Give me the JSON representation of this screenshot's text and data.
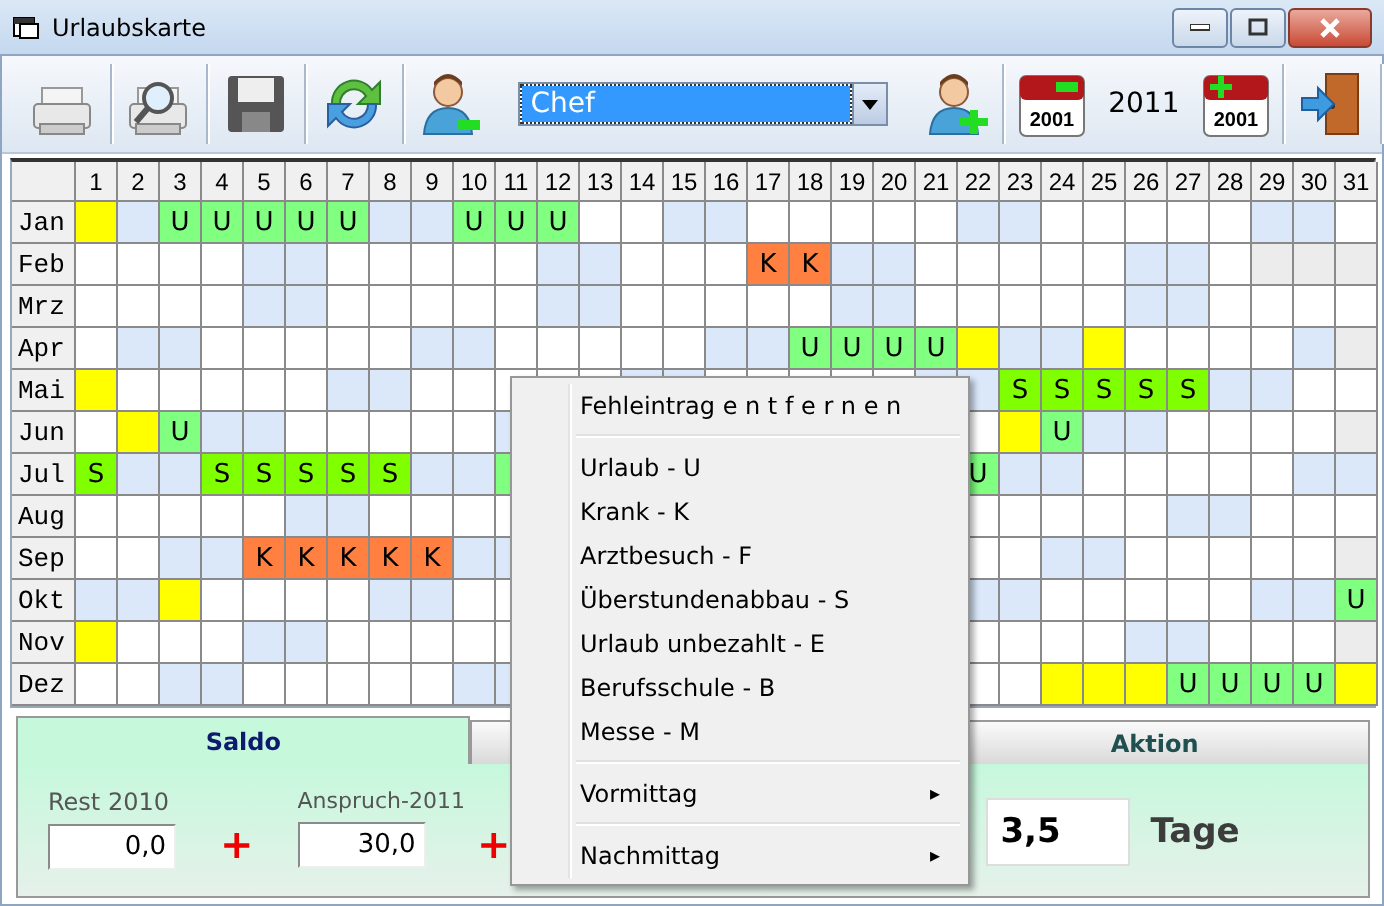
{
  "window": {
    "title": "Urlaubskarte"
  },
  "toolbar": {
    "user_select": "Chef",
    "prev_year_icon_text": "2001",
    "year": "2011",
    "next_year_icon_text": "2001"
  },
  "days": [
    "1",
    "2",
    "3",
    "4",
    "5",
    "6",
    "7",
    "8",
    "9",
    "10",
    "11",
    "12",
    "13",
    "14",
    "15",
    "16",
    "17",
    "18",
    "19",
    "20",
    "21",
    "22",
    "23",
    "24",
    "25",
    "26",
    "27",
    "28",
    "29",
    "30",
    "31"
  ],
  "months": [
    {
      "label": "Jan",
      "cells": [
        {
          "kind": "holiday"
        },
        {
          "kind": "weekend"
        },
        {
          "kind": "entry",
          "text": "U",
          "color": "#80ff80"
        },
        {
          "kind": "entry",
          "text": "U",
          "color": "#80ff80"
        },
        {
          "kind": "entry",
          "text": "U",
          "color": "#80ff80"
        },
        {
          "kind": "entry",
          "text": "U",
          "color": "#80ff80"
        },
        {
          "kind": "entry",
          "text": "U",
          "color": "#80ff80"
        },
        {
          "kind": "weekend"
        },
        {
          "kind": "weekend"
        },
        {
          "kind": "entry",
          "text": "U",
          "color": "#80ff80"
        },
        {
          "kind": "entry",
          "text": "U",
          "color": "#80ff80"
        },
        {
          "kind": "entry",
          "text": "U",
          "color": "#80ff80"
        },
        {
          "kind": "work"
        },
        {
          "kind": "work"
        },
        {
          "kind": "weekend"
        },
        {
          "kind": "weekend"
        },
        {
          "kind": "work"
        },
        {
          "kind": "work"
        },
        {
          "kind": "work"
        },
        {
          "kind": "work"
        },
        {
          "kind": "work"
        },
        {
          "kind": "weekend"
        },
        {
          "kind": "weekend"
        },
        {
          "kind": "work"
        },
        {
          "kind": "work"
        },
        {
          "kind": "work"
        },
        {
          "kind": "work"
        },
        {
          "kind": "work"
        },
        {
          "kind": "weekend"
        },
        {
          "kind": "weekend"
        },
        {
          "kind": "work"
        }
      ]
    },
    {
      "label": "Feb",
      "cells": [
        {
          "kind": "work"
        },
        {
          "kind": "work"
        },
        {
          "kind": "work"
        },
        {
          "kind": "work"
        },
        {
          "kind": "weekend"
        },
        {
          "kind": "weekend"
        },
        {
          "kind": "work"
        },
        {
          "kind": "work"
        },
        {
          "kind": "work"
        },
        {
          "kind": "work"
        },
        {
          "kind": "work"
        },
        {
          "kind": "weekend"
        },
        {
          "kind": "weekend"
        },
        {
          "kind": "work"
        },
        {
          "kind": "work"
        },
        {
          "kind": "work"
        },
        {
          "kind": "entry",
          "text": "K",
          "color": "#ff8040"
        },
        {
          "kind": "entry",
          "text": "K",
          "color": "#ff8040"
        },
        {
          "kind": "weekend"
        },
        {
          "kind": "weekend"
        },
        {
          "kind": "work"
        },
        {
          "kind": "work"
        },
        {
          "kind": "work"
        },
        {
          "kind": "work"
        },
        {
          "kind": "work"
        },
        {
          "kind": "weekend"
        },
        {
          "kind": "weekend"
        },
        {
          "kind": "work"
        },
        {
          "kind": "blank"
        },
        {
          "kind": "blank"
        },
        {
          "kind": "blank"
        }
      ]
    },
    {
      "label": "Mrz",
      "cells": [
        {
          "kind": "work"
        },
        {
          "kind": "work"
        },
        {
          "kind": "work"
        },
        {
          "kind": "work"
        },
        {
          "kind": "weekend"
        },
        {
          "kind": "weekend"
        },
        {
          "kind": "work"
        },
        {
          "kind": "work"
        },
        {
          "kind": "work"
        },
        {
          "kind": "work"
        },
        {
          "kind": "work"
        },
        {
          "kind": "weekend"
        },
        {
          "kind": "weekend"
        },
        {
          "kind": "work"
        },
        {
          "kind": "work"
        },
        {
          "kind": "work"
        },
        {
          "kind": "work"
        },
        {
          "kind": "work"
        },
        {
          "kind": "weekend"
        },
        {
          "kind": "weekend"
        },
        {
          "kind": "work"
        },
        {
          "kind": "work"
        },
        {
          "kind": "work"
        },
        {
          "kind": "work"
        },
        {
          "kind": "work"
        },
        {
          "kind": "weekend"
        },
        {
          "kind": "weekend"
        },
        {
          "kind": "work"
        },
        {
          "kind": "work"
        },
        {
          "kind": "work"
        },
        {
          "kind": "work"
        }
      ]
    },
    {
      "label": "Apr",
      "cells": [
        {
          "kind": "work"
        },
        {
          "kind": "weekend"
        },
        {
          "kind": "weekend"
        },
        {
          "kind": "work"
        },
        {
          "kind": "work"
        },
        {
          "kind": "work"
        },
        {
          "kind": "work"
        },
        {
          "kind": "work"
        },
        {
          "kind": "weekend"
        },
        {
          "kind": "weekend"
        },
        {
          "kind": "work"
        },
        {
          "kind": "work"
        },
        {
          "kind": "work"
        },
        {
          "kind": "work"
        },
        {
          "kind": "work"
        },
        {
          "kind": "weekend"
        },
        {
          "kind": "weekend"
        },
        {
          "kind": "entry",
          "text": "U",
          "color": "#80ff80"
        },
        {
          "kind": "entry",
          "text": "U",
          "color": "#80ff80"
        },
        {
          "kind": "entry",
          "text": "U",
          "color": "#80ff80"
        },
        {
          "kind": "entry",
          "text": "U",
          "color": "#80ff80"
        },
        {
          "kind": "holiday"
        },
        {
          "kind": "weekend"
        },
        {
          "kind": "weekend"
        },
        {
          "kind": "holiday"
        },
        {
          "kind": "work"
        },
        {
          "kind": "work"
        },
        {
          "kind": "work"
        },
        {
          "kind": "work"
        },
        {
          "kind": "weekend"
        },
        {
          "kind": "blank"
        }
      ]
    },
    {
      "label": "Mai",
      "cells": [
        {
          "kind": "holiday"
        },
        {
          "kind": "work"
        },
        {
          "kind": "work"
        },
        {
          "kind": "work"
        },
        {
          "kind": "work"
        },
        {
          "kind": "work"
        },
        {
          "kind": "weekend"
        },
        {
          "kind": "weekend"
        },
        {
          "kind": "work"
        },
        {
          "kind": "work"
        },
        {
          "kind": "work"
        },
        {
          "kind": "work"
        },
        {
          "kind": "work"
        },
        {
          "kind": "weekend"
        },
        {
          "kind": "weekend"
        },
        {
          "kind": "work"
        },
        {
          "kind": "work"
        },
        {
          "kind": "work"
        },
        {
          "kind": "work"
        },
        {
          "kind": "work"
        },
        {
          "kind": "weekend"
        },
        {
          "kind": "weekend"
        },
        {
          "kind": "entry",
          "text": "S",
          "color": "#80ff00"
        },
        {
          "kind": "entry",
          "text": "S",
          "color": "#80ff00"
        },
        {
          "kind": "entry",
          "text": "S",
          "color": "#80ff00"
        },
        {
          "kind": "entry",
          "text": "S",
          "color": "#80ff00"
        },
        {
          "kind": "entry",
          "text": "S",
          "color": "#80ff00"
        },
        {
          "kind": "weekend"
        },
        {
          "kind": "weekend"
        },
        {
          "kind": "work"
        },
        {
          "kind": "work"
        }
      ]
    },
    {
      "label": "Jun",
      "cells": [
        {
          "kind": "work"
        },
        {
          "kind": "holiday"
        },
        {
          "kind": "entry",
          "text": "U",
          "color": "#80ff80"
        },
        {
          "kind": "weekend"
        },
        {
          "kind": "weekend"
        },
        {
          "kind": "work"
        },
        {
          "kind": "work"
        },
        {
          "kind": "work"
        },
        {
          "kind": "work"
        },
        {
          "kind": "work"
        },
        {
          "kind": "weekend"
        },
        null,
        null,
        null,
        null,
        null,
        null,
        null,
        null,
        null,
        null,
        {
          "kind": "work"
        },
        {
          "kind": "holiday"
        },
        {
          "kind": "entry",
          "text": "U",
          "color": "#80ff80"
        },
        {
          "kind": "weekend"
        },
        {
          "kind": "weekend"
        },
        {
          "kind": "work"
        },
        {
          "kind": "work"
        },
        {
          "kind": "work"
        },
        {
          "kind": "work"
        },
        {
          "kind": "blank"
        }
      ]
    },
    {
      "label": "Jul",
      "cells": [
        {
          "kind": "entry",
          "text": "S",
          "color": "#80ff00"
        },
        {
          "kind": "weekend"
        },
        {
          "kind": "weekend"
        },
        {
          "kind": "entry",
          "text": "S",
          "color": "#80ff00"
        },
        {
          "kind": "entry",
          "text": "S",
          "color": "#80ff00"
        },
        {
          "kind": "entry",
          "text": "S",
          "color": "#80ff00"
        },
        {
          "kind": "entry",
          "text": "S",
          "color": "#80ff00"
        },
        {
          "kind": "entry",
          "text": "S",
          "color": "#80ff00"
        },
        {
          "kind": "weekend"
        },
        {
          "kind": "weekend"
        },
        {
          "kind": "entry",
          "color": "#80ff80"
        },
        null,
        null,
        null,
        null,
        null,
        null,
        null,
        null,
        null,
        null,
        {
          "kind": "entry",
          "text": "U",
          "color": "#80ff80"
        },
        {
          "kind": "weekend"
        },
        {
          "kind": "weekend"
        },
        {
          "kind": "work"
        },
        {
          "kind": "work"
        },
        {
          "kind": "work"
        },
        {
          "kind": "work"
        },
        {
          "kind": "work"
        },
        {
          "kind": "weekend"
        },
        {
          "kind": "weekend"
        }
      ]
    },
    {
      "label": "Aug",
      "cells": [
        {
          "kind": "work"
        },
        {
          "kind": "work"
        },
        {
          "kind": "work"
        },
        {
          "kind": "work"
        },
        {
          "kind": "work"
        },
        {
          "kind": "weekend"
        },
        {
          "kind": "weekend"
        },
        {
          "kind": "work"
        },
        {
          "kind": "work"
        },
        {
          "kind": "work"
        },
        {
          "kind": "work"
        },
        null,
        null,
        null,
        null,
        null,
        null,
        null,
        null,
        null,
        null,
        {
          "kind": "work"
        },
        {
          "kind": "work"
        },
        {
          "kind": "work"
        },
        {
          "kind": "work"
        },
        {
          "kind": "work"
        },
        {
          "kind": "weekend"
        },
        {
          "kind": "weekend"
        },
        {
          "kind": "work"
        },
        {
          "kind": "work"
        },
        {
          "kind": "work"
        }
      ]
    },
    {
      "label": "Sep",
      "cells": [
        {
          "kind": "work"
        },
        {
          "kind": "work"
        },
        {
          "kind": "weekend"
        },
        {
          "kind": "weekend"
        },
        {
          "kind": "entry",
          "text": "K",
          "color": "#ff8040"
        },
        {
          "kind": "entry",
          "text": "K",
          "color": "#ff8040"
        },
        {
          "kind": "entry",
          "text": "K",
          "color": "#ff8040"
        },
        {
          "kind": "entry",
          "text": "K",
          "color": "#ff8040"
        },
        {
          "kind": "entry",
          "text": "K",
          "color": "#ff8040"
        },
        {
          "kind": "weekend"
        },
        {
          "kind": "weekend"
        },
        null,
        null,
        null,
        null,
        null,
        null,
        null,
        null,
        null,
        null,
        {
          "kind": "work"
        },
        {
          "kind": "work"
        },
        {
          "kind": "weekend"
        },
        {
          "kind": "weekend"
        },
        {
          "kind": "work"
        },
        {
          "kind": "work"
        },
        {
          "kind": "work"
        },
        {
          "kind": "work"
        },
        {
          "kind": "work"
        },
        {
          "kind": "blank"
        }
      ]
    },
    {
      "label": "Okt",
      "cells": [
        {
          "kind": "weekend"
        },
        {
          "kind": "weekend"
        },
        {
          "kind": "holiday"
        },
        {
          "kind": "work"
        },
        {
          "kind": "work"
        },
        {
          "kind": "work"
        },
        {
          "kind": "work"
        },
        {
          "kind": "weekend"
        },
        {
          "kind": "weekend"
        },
        {
          "kind": "work"
        },
        {
          "kind": "work"
        },
        null,
        null,
        null,
        null,
        null,
        null,
        null,
        null,
        null,
        null,
        {
          "kind": "weekend"
        },
        {
          "kind": "weekend"
        },
        {
          "kind": "work"
        },
        {
          "kind": "work"
        },
        {
          "kind": "work"
        },
        {
          "kind": "work"
        },
        {
          "kind": "work"
        },
        {
          "kind": "weekend"
        },
        {
          "kind": "weekend"
        },
        {
          "kind": "entry",
          "text": "U",
          "color": "#80ff80"
        }
      ]
    },
    {
      "label": "Nov",
      "cells": [
        {
          "kind": "holiday"
        },
        {
          "kind": "work"
        },
        {
          "kind": "work"
        },
        {
          "kind": "work"
        },
        {
          "kind": "weekend"
        },
        {
          "kind": "weekend"
        },
        {
          "kind": "work"
        },
        {
          "kind": "work"
        },
        {
          "kind": "work"
        },
        {
          "kind": "work"
        },
        {
          "kind": "work"
        },
        null,
        null,
        null,
        null,
        null,
        null,
        null,
        null,
        null,
        null,
        {
          "kind": "work"
        },
        {
          "kind": "work"
        },
        {
          "kind": "work"
        },
        {
          "kind": "work"
        },
        {
          "kind": "weekend"
        },
        {
          "kind": "weekend"
        },
        {
          "kind": "work"
        },
        {
          "kind": "work"
        },
        {
          "kind": "work"
        },
        {
          "kind": "blank"
        }
      ]
    },
    {
      "label": "Dez",
      "cells": [
        {
          "kind": "work"
        },
        {
          "kind": "work"
        },
        {
          "kind": "weekend"
        },
        {
          "kind": "weekend"
        },
        {
          "kind": "work"
        },
        {
          "kind": "work"
        },
        {
          "kind": "work"
        },
        {
          "kind": "work"
        },
        {
          "kind": "work"
        },
        {
          "kind": "weekend"
        },
        {
          "kind": "weekend"
        },
        null,
        null,
        null,
        null,
        null,
        null,
        null,
        null,
        null,
        null,
        {
          "kind": "work"
        },
        {
          "kind": "work"
        },
        {
          "kind": "holiday"
        },
        {
          "kind": "holiday"
        },
        {
          "kind": "holiday"
        },
        {
          "kind": "entry",
          "text": "U",
          "color": "#80ff80"
        },
        {
          "kind": "entry",
          "text": "U",
          "color": "#80ff80"
        },
        {
          "kind": "entry",
          "text": "U",
          "color": "#80ff80"
        },
        {
          "kind": "entry",
          "text": "U",
          "color": "#80ff80"
        },
        {
          "kind": "holiday"
        }
      ]
    }
  ],
  "panel": {
    "tabs": [
      {
        "label": "Saldo",
        "selected": true
      },
      {
        "label": "Aktion",
        "selected": false
      }
    ],
    "rest": {
      "label": "Rest 2010",
      "value": "0,0"
    },
    "anspruch": {
      "label": "Anspruch-2011",
      "value": "30,0"
    },
    "plus_signs": [
      "+",
      "+"
    ],
    "result": {
      "value": "3,5",
      "unit": "Tage"
    }
  },
  "context_menu": {
    "items": [
      {
        "kind": "action",
        "label": "Fehleintrag e n t f e r n e n"
      },
      {
        "kind": "separator"
      },
      {
        "kind": "action",
        "label": "Urlaub - U"
      },
      {
        "kind": "action",
        "label": "Krank - K"
      },
      {
        "kind": "action",
        "label": "Arztbesuch - F"
      },
      {
        "kind": "action",
        "label": "Überstundenabbau - S"
      },
      {
        "kind": "action",
        "label": "Urlaub unbezahlt - E"
      },
      {
        "kind": "action",
        "label": "Berufsschule - B"
      },
      {
        "kind": "action",
        "label": "Messe - M"
      },
      {
        "kind": "separator"
      },
      {
        "kind": "submenu",
        "label": "Vormittag",
        "arrow": "▸"
      },
      {
        "kind": "separator"
      },
      {
        "kind": "submenu",
        "label": "Nachmittag",
        "arrow": "▸"
      }
    ]
  }
}
